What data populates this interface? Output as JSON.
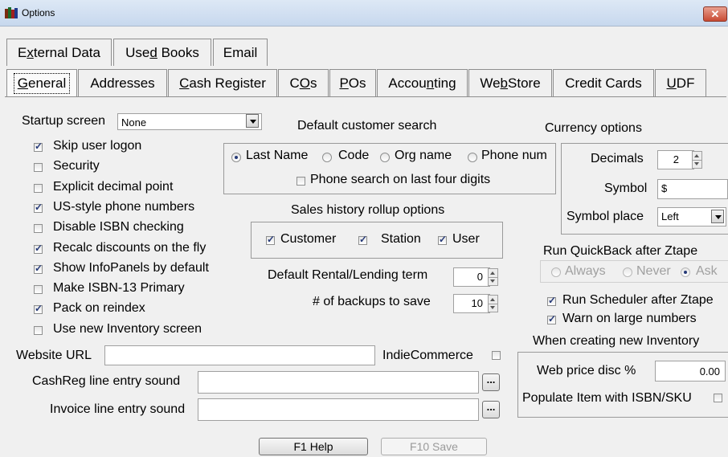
{
  "window": {
    "title": "Options",
    "close_symbol": "✕"
  },
  "tabs_row1": [
    {
      "pre": "E",
      "key": "x",
      "post": "ternal Data"
    },
    {
      "pre": "Use",
      "key": "d",
      "post": " Books"
    },
    {
      "pre": "",
      "key": "",
      "post": "Email"
    }
  ],
  "tabs_row2": [
    {
      "pre": "",
      "key": "G",
      "post": "eneral"
    },
    {
      "pre": "",
      "key": "",
      "post": "Addresses"
    },
    {
      "pre": "",
      "key": "C",
      "post": "ash Register"
    },
    {
      "pre": "C",
      "key": "O",
      "post": "s"
    },
    {
      "pre": "",
      "key": "P",
      "post": "Os"
    },
    {
      "pre": "Accou",
      "key": "n",
      "post": "ting"
    },
    {
      "pre": "We",
      "key": "b",
      "post": "Store"
    },
    {
      "pre": "",
      "key": "",
      "post": "Credit Cards"
    },
    {
      "pre": "",
      "key": "U",
      "post": "DF"
    }
  ],
  "startup": {
    "label": "Startup screen",
    "value": "None"
  },
  "options": [
    {
      "label": "Skip user logon",
      "checked": true
    },
    {
      "label": "Security",
      "checked": false
    },
    {
      "label": "Explicit decimal point",
      "checked": false
    },
    {
      "label": "US-style phone numbers",
      "checked": true
    },
    {
      "label": "Disable ISBN checking",
      "checked": false
    },
    {
      "label": "Recalc discounts on the fly",
      "checked": true
    },
    {
      "label": "Show InfoPanels by default",
      "checked": true
    },
    {
      "label": "Make ISBN-13 Primary",
      "checked": false
    },
    {
      "label": "Pack on reindex",
      "checked": true
    },
    {
      "label": "Use new Inventory screen",
      "checked": false
    }
  ],
  "customer_search": {
    "title": "Default customer search",
    "options": [
      "Last Name",
      "Code",
      "Org name",
      "Phone num"
    ],
    "selected": "Last Name",
    "last_four_label": "Phone search on last four digits",
    "last_four_checked": false
  },
  "sales_history": {
    "title": "Sales history rollup options",
    "options": [
      {
        "label": "Customer",
        "checked": true
      },
      {
        "label": "Station",
        "checked": true
      },
      {
        "label": "User",
        "checked": true
      }
    ]
  },
  "rental_term": {
    "label": "Default Rental/Lending term",
    "value": "0"
  },
  "backups": {
    "label": "# of backups to save",
    "value": "10"
  },
  "currency": {
    "title": "Currency options",
    "decimals_label": "Decimals",
    "decimals_value": "2",
    "symbol_label": "Symbol",
    "symbol_value": "$",
    "place_label": "Symbol place",
    "place_value": "Left"
  },
  "quickback": {
    "title": "Run QuickBack after Ztape",
    "options": [
      "Always",
      "Never",
      "Ask"
    ],
    "selected": "Ask"
  },
  "run_scheduler": {
    "label": "Run Scheduler after Ztape",
    "checked": true
  },
  "warn_large": {
    "label": "Warn on large numbers",
    "checked": true
  },
  "new_inventory": {
    "title": "When creating new Inventory",
    "web_price_label": "Web price disc %",
    "web_price_value": "0.00",
    "populate_label": "Populate Item with ISBN/SKU",
    "populate_checked": false
  },
  "website": {
    "label": "Website URL",
    "value": ""
  },
  "indie": {
    "label": "IndieCommerce",
    "checked": false
  },
  "cashreg_sound": {
    "label": "CashReg line entry sound",
    "value": "",
    "browse": "..."
  },
  "invoice_sound": {
    "label": "Invoice line entry sound",
    "value": "",
    "browse": "..."
  },
  "buttons": {
    "help": "F1 Help",
    "save": "F10 Save"
  }
}
